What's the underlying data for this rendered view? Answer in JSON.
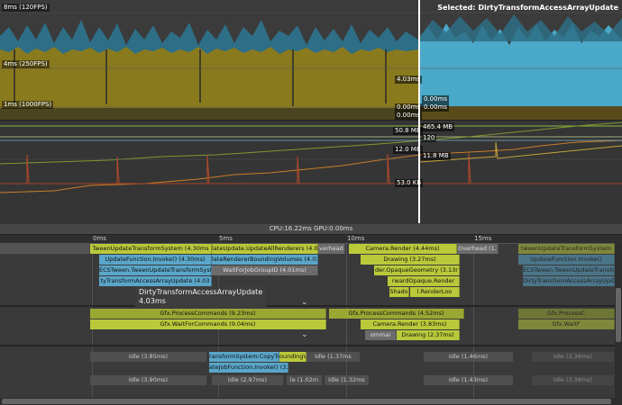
{
  "cpu_chart": {
    "selected_label": "Selected: DirtyTransformAccessArrayUpdate",
    "axis_labels": [
      "8ms (120FPS)",
      "4ms (250FPS)",
      "1ms (1000FPS)"
    ],
    "value_labels": [
      "4.03ms",
      "0.00ms",
      "0.00ms",
      "0.00ms",
      "0.00ms"
    ],
    "colors": {
      "scripts": "#8a7a1e",
      "selected": "#4aa8c8",
      "teal": "#2e6e86"
    }
  },
  "memory_chart": {
    "value_labels": [
      "465.4 MB",
      "50.8 MB",
      "120",
      "12.0 MB",
      "11.8 MB",
      "53.0 KB"
    ]
  },
  "timeline": {
    "header": "CPU:16.22ms   GPU:0.00ms",
    "ticks": [
      "0ms",
      "5ms",
      "10ms",
      "15ms"
    ],
    "main_rows": [
      [
        "TweenUpdateTransformSystem (4.30ms",
        "lateUpdate.UpdateAllRenderers (4.04",
        "verhead",
        "Camera.Render (4.44ms)",
        "Overhead (1.",
        "tweenUpdateTransformSystem"
      ],
      [
        "UpdateFunction.Invoke() (4.30ms)",
        "lateRendererBoundingVolumes (4.03n",
        "Drawing (3.27ms)",
        "UpdateFunction.Invoke()"
      ],
      [
        "ECSTween.TweenUpdateTransformSyst",
        "WaitForJobGroupID (4.01ms)",
        "der.OpaqueGeometry (3.13r",
        "ECSTween.TweenUpdateTransfo"
      ],
      [
        "tyTransformAccessArrayUpdate (4.03",
        "rwardOpaque.Render",
        "DirtyTransformAccessArrayUpdate (4."
      ],
      [
        "Shado",
        "l.RenderLoo"
      ]
    ],
    "tooltip": {
      "title": "DirtyTransformAccessArrayUpdate",
      "value": "4.03ms"
    },
    "render_rows": [
      [
        "Gfx.ProcessCommands (9.23ms)",
        "Gfx.ProcessCommands (4.52ms)",
        "Gfx.ProcessC"
      ],
      [
        "Gfx.WaitForCommands (9.04ms)",
        "Camera.Render (3.83ms)",
        "Gfx.WaitF"
      ],
      [
        "ommai",
        "Drawing (2.37ms)"
      ]
    ],
    "worker_rows": [
      [
        "Idle (3.85ms)",
        "ransformSystem:CopyTrans",
        "oundingVo",
        "Idle (1.37ms",
        "Idle (1.46ms)",
        "Idle (3.36ms)"
      ],
      [
        "ateJobFunction.Invoke() (3.0"
      ],
      [
        "Idle (3.90ms)",
        "Idle (2.97ms)",
        "le (1.02m",
        "Idle (1.32ms",
        "Idle (1.43ms)",
        "Idle (3.38ms)"
      ]
    ]
  }
}
